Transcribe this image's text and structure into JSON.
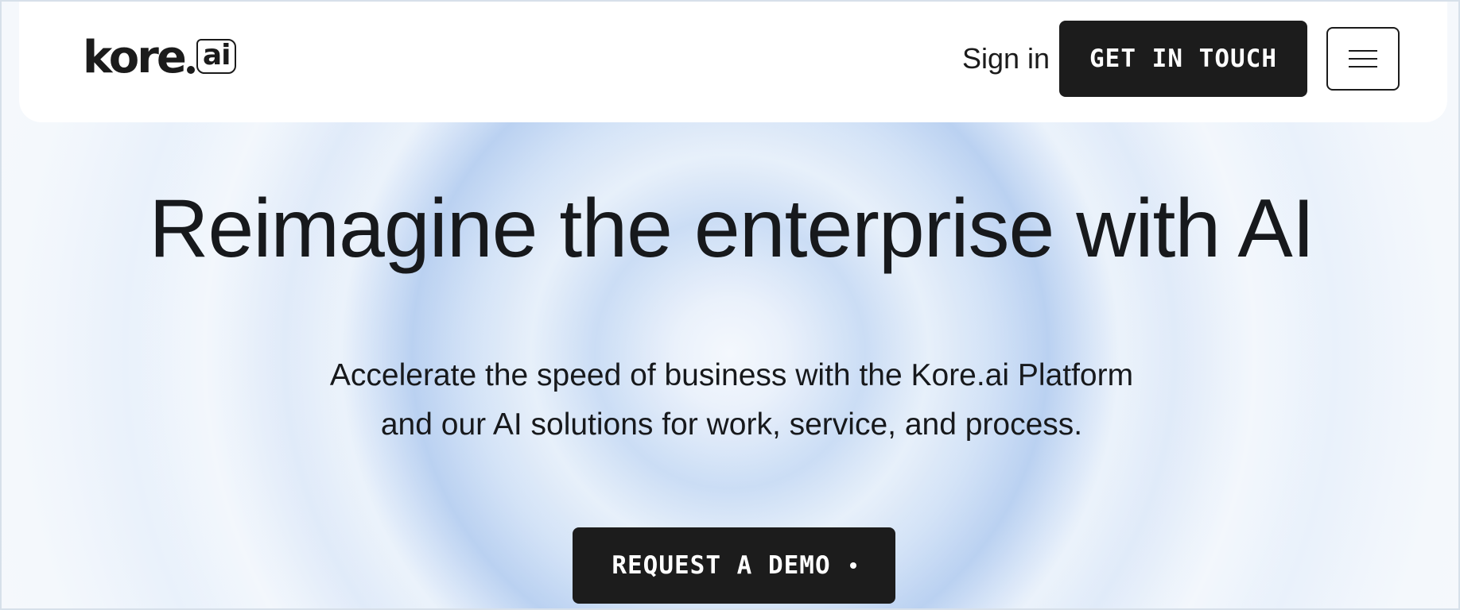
{
  "header": {
    "logo": {
      "word": "kore",
      "suffix": "ai"
    },
    "sign_in_label": "Sign in",
    "cta_label": "GET IN TOUCH",
    "menu_icon": "hamburger-menu-icon"
  },
  "hero": {
    "title": "Reimagine the enterprise with AI",
    "subtitle_lines": [
      "Accelerate the speed of business with the Kore.ai Platform",
      "and our AI solutions for work, service, and process."
    ],
    "cta_label": "REQUEST A DEMO",
    "cta_icon": "dot-icon"
  },
  "colors": {
    "primary_button": "#1c1c1c",
    "text": "#17191c",
    "header_bg": "#ffffff",
    "background_accent": "#c9dcf5"
  }
}
